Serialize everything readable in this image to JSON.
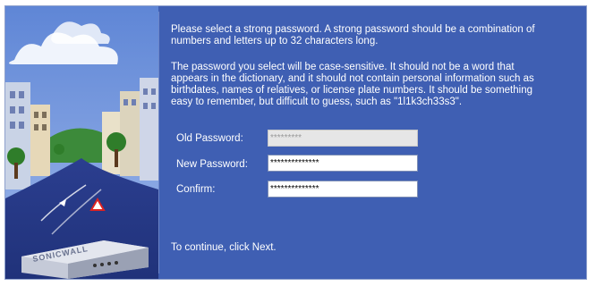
{
  "intro": {
    "paragraph1": "Please select a strong password. A strong password should be a combination of numbers and letters up to 32 characters long.",
    "paragraph2": "The password you select will be case-sensitive. It should not be a word that appears in the dictionary, and it should not contain personal information such as birthdates, names of relatives, or license plate numbers. It should be something easy to remember, but difficult to guess, such as \"1l1k3ch33s3\"."
  },
  "form": {
    "old_password": {
      "label": "Old Password:",
      "value": "*********",
      "disabled": true
    },
    "new_password": {
      "label": "New Password:",
      "value": "**************"
    },
    "confirm": {
      "label": "Confirm:",
      "value": "**************"
    }
  },
  "footer": {
    "continue_text": "To continue, click Next."
  },
  "branding": {
    "logo_text": "SONICWALL"
  },
  "colors": {
    "panel": "#3f5fb3",
    "text": "#ffffff"
  }
}
